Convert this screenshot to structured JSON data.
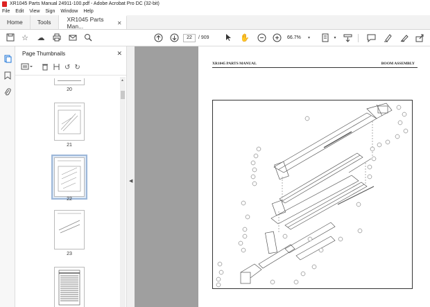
{
  "window": {
    "title": "XR1045 Parts Manual 24911-100.pdf - Adobe Acrobat Pro DC (32-bit)"
  },
  "menu": [
    "File",
    "Edit",
    "View",
    "Sign",
    "Window",
    "Help"
  ],
  "tabs": {
    "home": "Home",
    "tools": "Tools",
    "document": "XR1045 Parts Man..."
  },
  "toolbar": {
    "current_page": "22",
    "total_pages": "/ 909",
    "zoom": "66.7%"
  },
  "thumbnails": {
    "title": "Page Thumbnails",
    "pages": [
      "20",
      "21",
      "22",
      "23"
    ],
    "selected": "22"
  },
  "document": {
    "header_left": "XR1045 PARTS MANUAL",
    "header_right": "BOOM ASSEMBLY"
  },
  "colors": {
    "accent": "#d22222",
    "panel": "#f7f7f7",
    "doc_bg": "#9f9f9f",
    "selection": "#dce7f4"
  }
}
